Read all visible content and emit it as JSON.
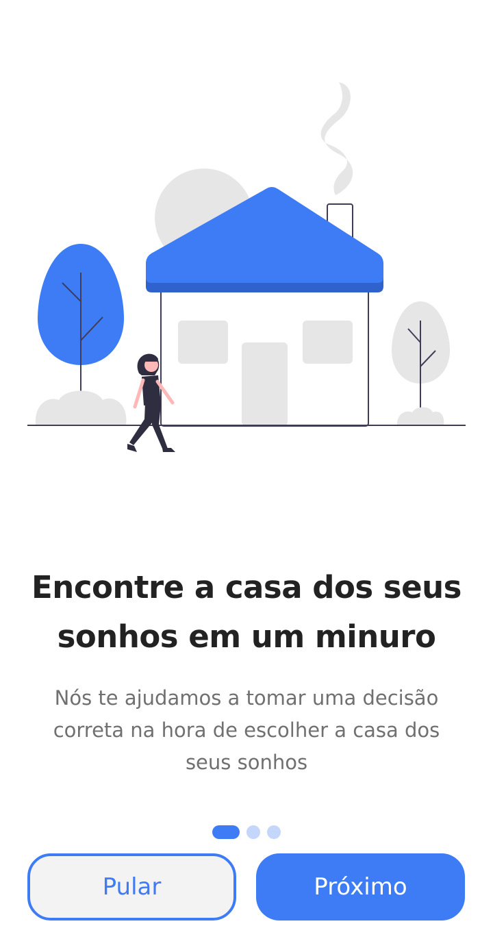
{
  "onboarding": {
    "title_lines": [
      "Encontre a casa dos seus",
      "sonhos em um minuro"
    ],
    "description_lines": [
      "Nós te ajudamos a tomar uma decisão",
      "correta na hora de escolher a casa dos",
      "seus sonhos"
    ],
    "page_indicator": {
      "total": 3,
      "current": 1
    },
    "skip_label": "Pular",
    "next_label": "Próximo"
  },
  "colors": {
    "primary": "#3d7cf5",
    "primary_dark": "#2f62cc",
    "dot_inactive": "#c5d6fb",
    "text_dark": "#222222",
    "text_muted": "#707070",
    "illustration_gray": "#e6e6e6",
    "ground_line": "#3f3d56"
  },
  "illustration": {
    "icon": "house-illustration",
    "elements": [
      "sun-icon",
      "house-icon",
      "chimney-smoke-icon",
      "tree-icon",
      "bush-icon",
      "woman-walking-icon"
    ]
  }
}
